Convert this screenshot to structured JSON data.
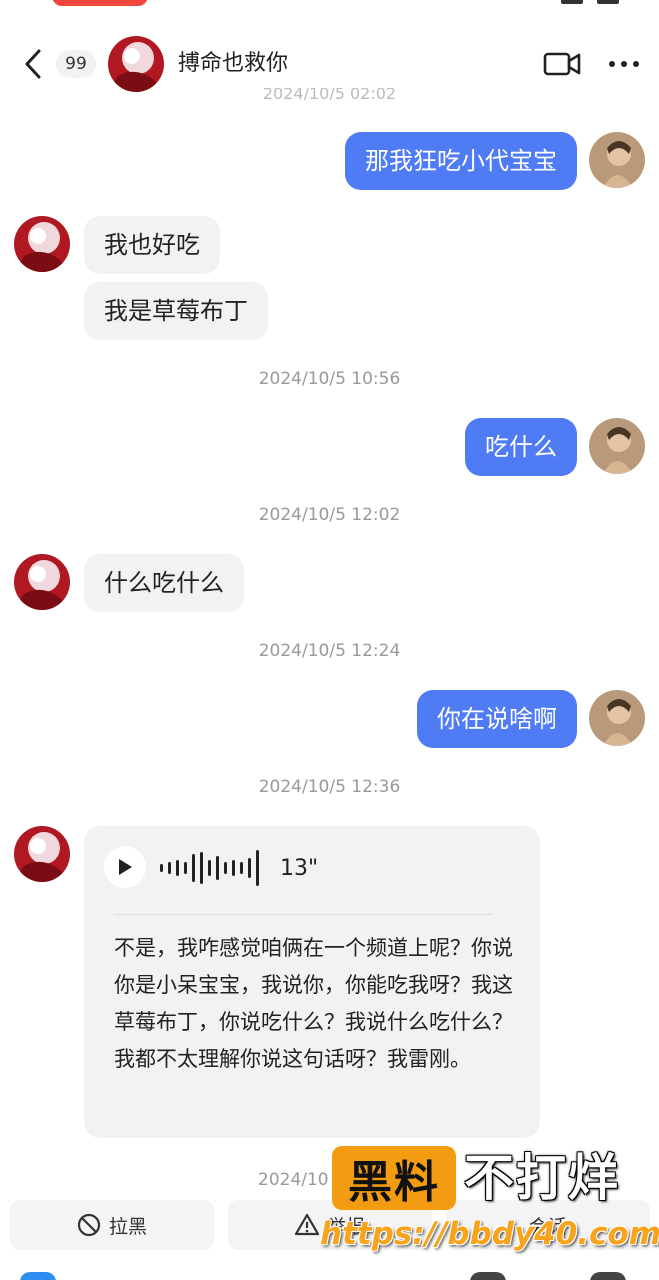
{
  "header": {
    "back_icon": "chevron-left-icon",
    "unread_count": "99",
    "title": "搏命也救你",
    "video_icon": "video-camera-icon",
    "more_icon": "more-dots-icon"
  },
  "colors": {
    "outgoing_bubble": "#4f7cf5",
    "incoming_bubble": "#f2f2f4",
    "timestamp": "#999999",
    "watermark_orange": "#f39c12"
  },
  "messages": {
    "m1": "那我狂吃小代宝宝",
    "m2": "我也好吃",
    "m3": "我是草莓布丁",
    "t1": "2024/10/5 10:56",
    "m4": "吃什么",
    "t2": "2024/10/5 12:02",
    "m5": "什么吃什么",
    "t3": "2024/10/5 12:24",
    "m6": "你在说啥啊",
    "t4": "2024/10/5 12:36",
    "t5": "2024/10"
  },
  "voice": {
    "duration": "13\"",
    "transcript": "不是，我咋感觉咱俩在一个频道上呢？你说你是小呆宝宝，我说你，你能吃我呀？我这草莓布丁，你说吃什么？我说什么吃什么？我都不太理解你说这句话呀？我雷刚。"
  },
  "bottom": {
    "block_label": "拉黑",
    "block_icon": "block-icon",
    "report_icon": "warning-icon",
    "report_label": "举报",
    "third_label": "会话"
  },
  "watermark": {
    "badge": "黑料",
    "text": "不打烊",
    "url": "https://bbdy40.com"
  }
}
